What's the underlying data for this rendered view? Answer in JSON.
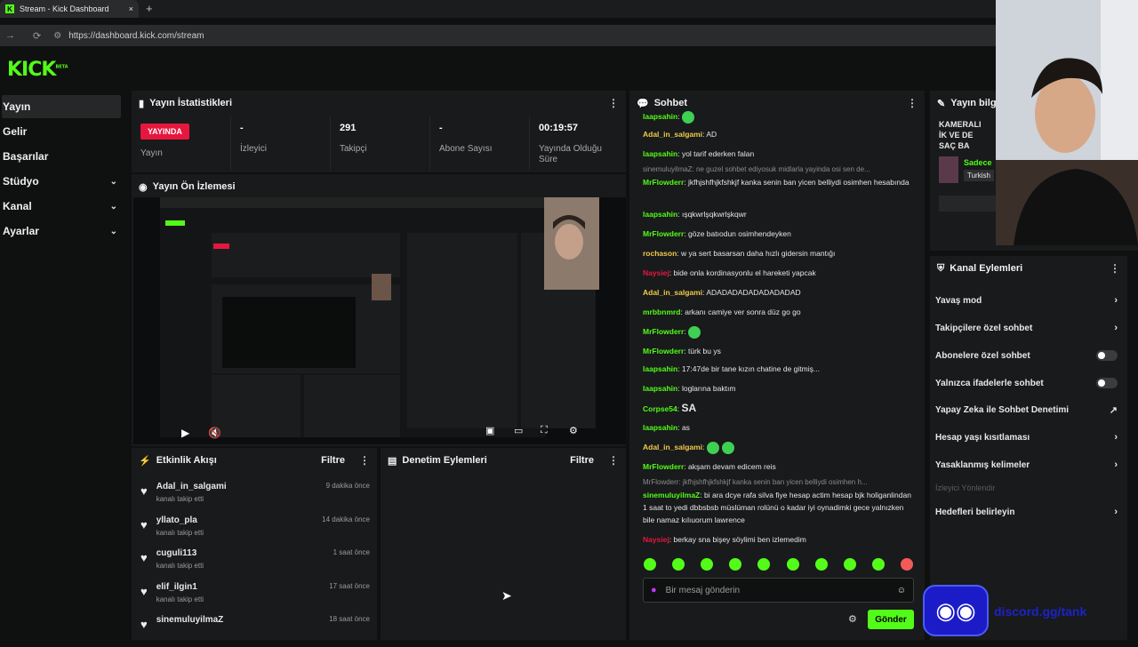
{
  "browser": {
    "tab_title": "Stream - Kick Dashboard",
    "new_tab": "+",
    "close": "×",
    "url": "https://dashboard.kick.com/stream",
    "back": "←",
    "forward": "→",
    "reload": "⟳"
  },
  "logo": {
    "text": "KICK",
    "beta": "BETA"
  },
  "sidebar": {
    "items": [
      {
        "label": "Yayın",
        "active": true,
        "chevron": false
      },
      {
        "label": "Gelir",
        "active": false,
        "chevron": false
      },
      {
        "label": "Başarılar",
        "active": false,
        "chevron": false
      },
      {
        "label": "Stüdyo",
        "active": false,
        "chevron": true
      },
      {
        "label": "Kanal",
        "active": false,
        "chevron": true
      },
      {
        "label": "Ayarlar",
        "active": false,
        "chevron": true
      }
    ]
  },
  "stats": {
    "title": "Yayın İstatistikleri",
    "live_badge": "YAYINDA",
    "live_label": "Yayın",
    "viewers": {
      "value": "-",
      "label": "İzleyici"
    },
    "followers": {
      "value": "291",
      "label": "Takipçi"
    },
    "subs": {
      "value": "-",
      "label": "Abone Sayısı"
    },
    "uptime": {
      "value": "00:19:57",
      "label": "Yayında Olduğu Süre"
    }
  },
  "preview": {
    "title": "Yayın Ön İzlemesi"
  },
  "activity": {
    "title": "Etkinlik Akışı",
    "filter": "Filtre",
    "items": [
      {
        "name": "Adal_in_salgami",
        "sub": "kanalı takip etti",
        "time": "9 dakika önce"
      },
      {
        "name": "yllato_pla",
        "sub": "kanalı takip etti",
        "time": "14 dakika önce"
      },
      {
        "name": "cuguli113",
        "sub": "kanalı takip etti",
        "time": "1 saat önce"
      },
      {
        "name": "elif_ilgin1",
        "sub": "kanalı takip etti",
        "time": "17 saat önce"
      },
      {
        "name": "sinemuluyilmaZ",
        "sub": "",
        "time": "18 saat önce"
      }
    ]
  },
  "moderation": {
    "title": "Denetim Eylemleri",
    "filter": "Filtre"
  },
  "chat": {
    "title": "Sohbet",
    "input_placeholder": "Bir mesaj gönderin",
    "send": "Gönder",
    "messages": [
      {
        "user": "laapsahin",
        "color": "#53fc18",
        "text": ""
      },
      {
        "user": "Adal_in_salgami",
        "color": "#f2c94c",
        "text": "AD"
      },
      {
        "user": "laapsahin",
        "color": "#53fc18",
        "text": "yol tarif ederken falan"
      },
      {
        "user": "MrFlowderr",
        "color": "#53fc18",
        "text": "jkfhjshfhjkfshkjf kanka senin ban yicen belliydi osimhen hesabında"
      },
      {
        "user": "laapsahin",
        "color": "#53fc18",
        "text": "ışqkwrlşqkwrlşkqwr"
      },
      {
        "user": "MrFlowderr",
        "color": "#53fc18",
        "text": "göze batıodun osimhendeyken"
      },
      {
        "user": "rochason",
        "color": "#f2c94c",
        "text": "w ya sert basarsan daha hızlı gidersin mantığı"
      },
      {
        "user": "Naysiej",
        "color": "#e5173f",
        "text": "bide onla kordinasyonlu el hareketi yapcak"
      },
      {
        "user": "Adal_in_salgami",
        "color": "#f2c94c",
        "text": "ADADADADADADADADAD"
      },
      {
        "user": "mrbbnmrd",
        "color": "#53fc18",
        "text": "arkanı camiye ver sonra düz go go"
      },
      {
        "user": "MrFlowderr",
        "color": "#53fc18",
        "text": ""
      },
      {
        "user": "MrFlowderr",
        "color": "#53fc18",
        "text": "türk bu ys"
      },
      {
        "user": "laapsahin",
        "color": "#53fc18",
        "text": "17:47de bir tane kızın chatine de gitmiş..."
      },
      {
        "user": "laapsahin",
        "color": "#53fc18",
        "text": "loglarına baktım"
      },
      {
        "user": "Corpse54",
        "color": "#53fc18",
        "text": "SA"
      },
      {
        "user": "laapsahin",
        "color": "#53fc18",
        "text": "as"
      },
      {
        "user": "Adal_in_salgami",
        "color": "#f2c94c",
        "text": ""
      },
      {
        "user": "MrFlowderr",
        "color": "#53fc18",
        "text": "akşam devam edicem reis"
      },
      {
        "user": "sinemuluyilmaZ",
        "color": "#53fc18",
        "text": "bi ara dcye rafa silva fiye hesap actim hesap bjk holiganlindan 1 saat to yedi dbbsbsb müslüman rolünü o kadar iyi oynadimki gece yalnızken bile namaz kılıuorum lawrence"
      },
      {
        "user": "Naysiej",
        "color": "#e5173f",
        "text": "berkay sna bişey söylimi ben izlemedim"
      }
    ],
    "reply1": "sinemuluyilmaZ: ne guzel sohbet ediyosuk midlarla yayinda osi sen de...",
    "reply2": "MrFlowderr: jkfhjshfhjkfshkjf kanka senin ban yicen belliydi osimhen h..."
  },
  "info": {
    "title": "Yayın bilgisi",
    "stream_title": "KAMERALI İK VE DE SAÇ BA",
    "category": "Sadece",
    "tag": "Turkish"
  },
  "channel_actions": {
    "title": "Kanal Eylemleri",
    "viewer_targeting": "İzleyici Yönlendir",
    "items": [
      {
        "label": "Yavaş mod",
        "control": "arrow"
      },
      {
        "label": "Takipçilere özel sohbet",
        "control": "arrow"
      },
      {
        "label": "Abonelere özel sohbet",
        "control": "toggle"
      },
      {
        "label": "Yalnızca ifadelerle sohbet",
        "control": "toggle"
      },
      {
        "label": "Yapay Zeka ile Sohbet Denetimi",
        "control": "ext"
      },
      {
        "label": "Hesap yaşı kısıtlaması",
        "control": "arrow"
      },
      {
        "label": "Yasaklanmış kelimeler",
        "control": "arrow"
      },
      {
        "label": "Hedefleri belirleyin",
        "control": "arrow"
      }
    ]
  },
  "overlay": {
    "discord_text": "discord.gg/tank"
  },
  "colors": {
    "accent": "#53fc18",
    "live": "#e5173f",
    "panel": "#181a1b",
    "bg": "#0f1010"
  }
}
